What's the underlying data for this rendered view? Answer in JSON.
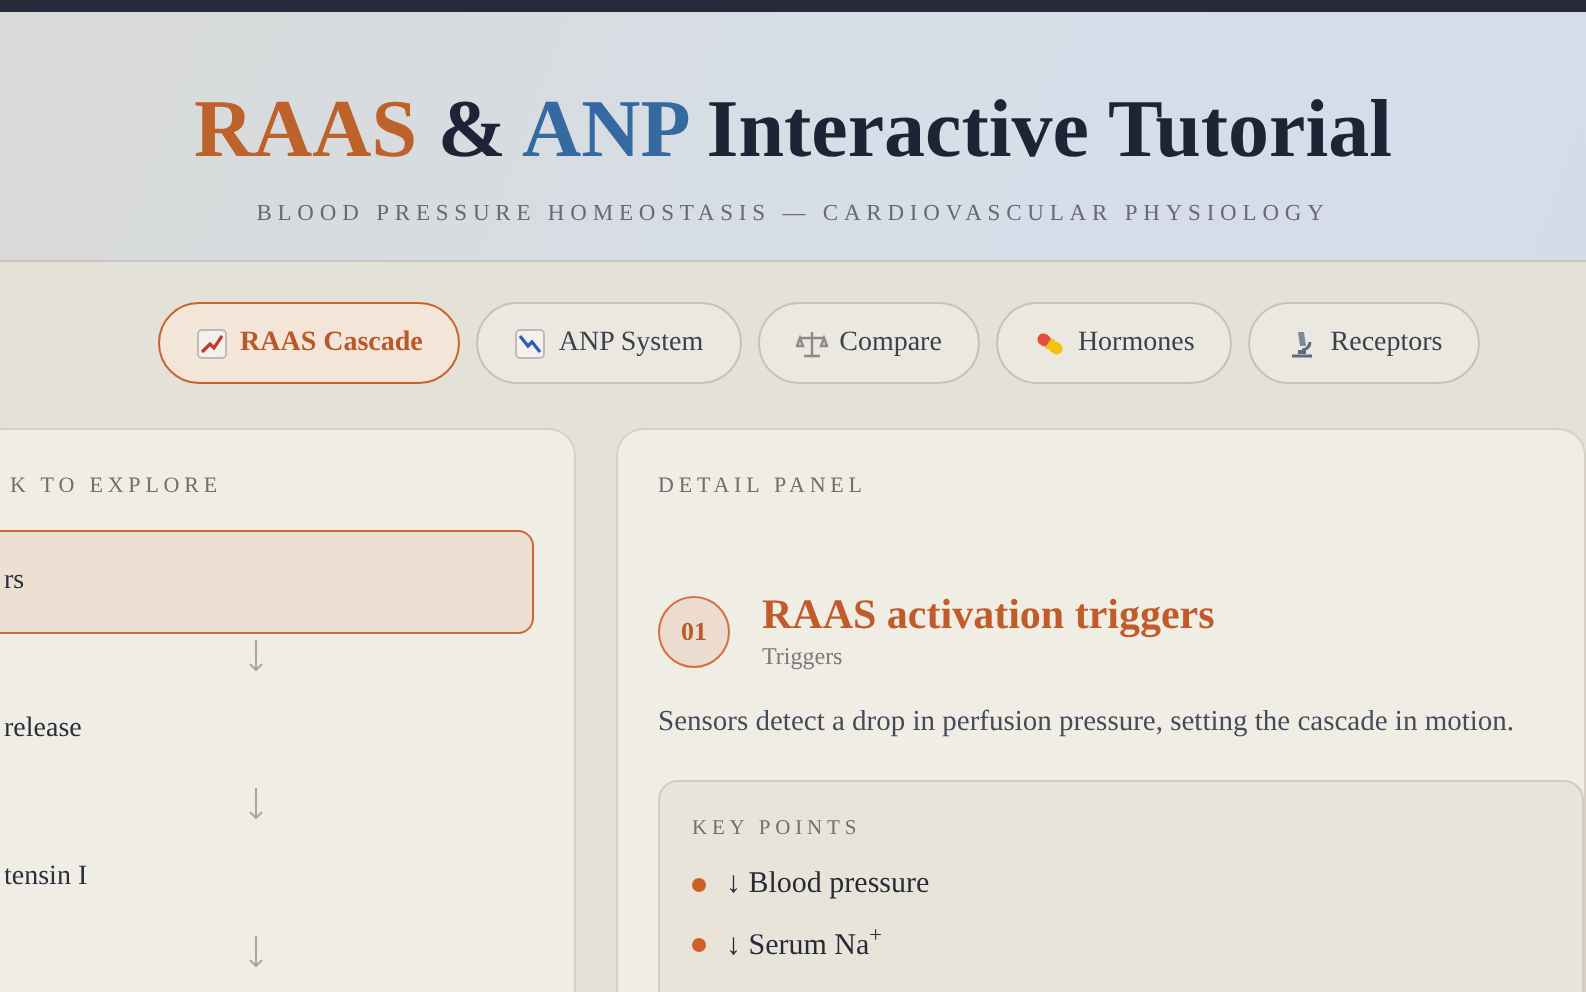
{
  "header": {
    "title_parts": [
      {
        "text": "RAAS",
        "kind": "raas"
      },
      {
        "text": "&",
        "kind": "plain"
      },
      {
        "text": "ANP",
        "kind": "anp"
      },
      {
        "text": "Interactive Tutorial",
        "kind": "plain"
      }
    ],
    "subtitle": "BLOOD PRESSURE HOMEOSTASIS — CARDIOVASCULAR PHYSIOLOGY"
  },
  "tabs": [
    {
      "label": "RAAS Cascade",
      "selected": true
    },
    {
      "label": "ANP System",
      "selected": false
    },
    {
      "label": "Compare",
      "selected": false
    },
    {
      "label": "Hormones",
      "selected": false
    },
    {
      "label": "Receptors",
      "selected": false
    }
  ],
  "steps_panel": {
    "heading": "K TO EXPLORE",
    "steps": [
      {
        "label": "rs",
        "selected": true
      },
      {
        "label": "release",
        "selected": false
      },
      {
        "label": "tensin I",
        "selected": false
      }
    ]
  },
  "detail_panel": {
    "heading": "DETAIL PANEL",
    "number": "01",
    "title": "RAAS activation triggers",
    "subtitle": "Triggers",
    "description": "Sensors detect a drop in perfusion pressure, setting the cascade in motion.",
    "key_points": {
      "heading": "KEY POINTS",
      "items": [
        "↓ Blood pressure",
        "↓ Serum Na$^{+}$"
      ]
    }
  }
}
